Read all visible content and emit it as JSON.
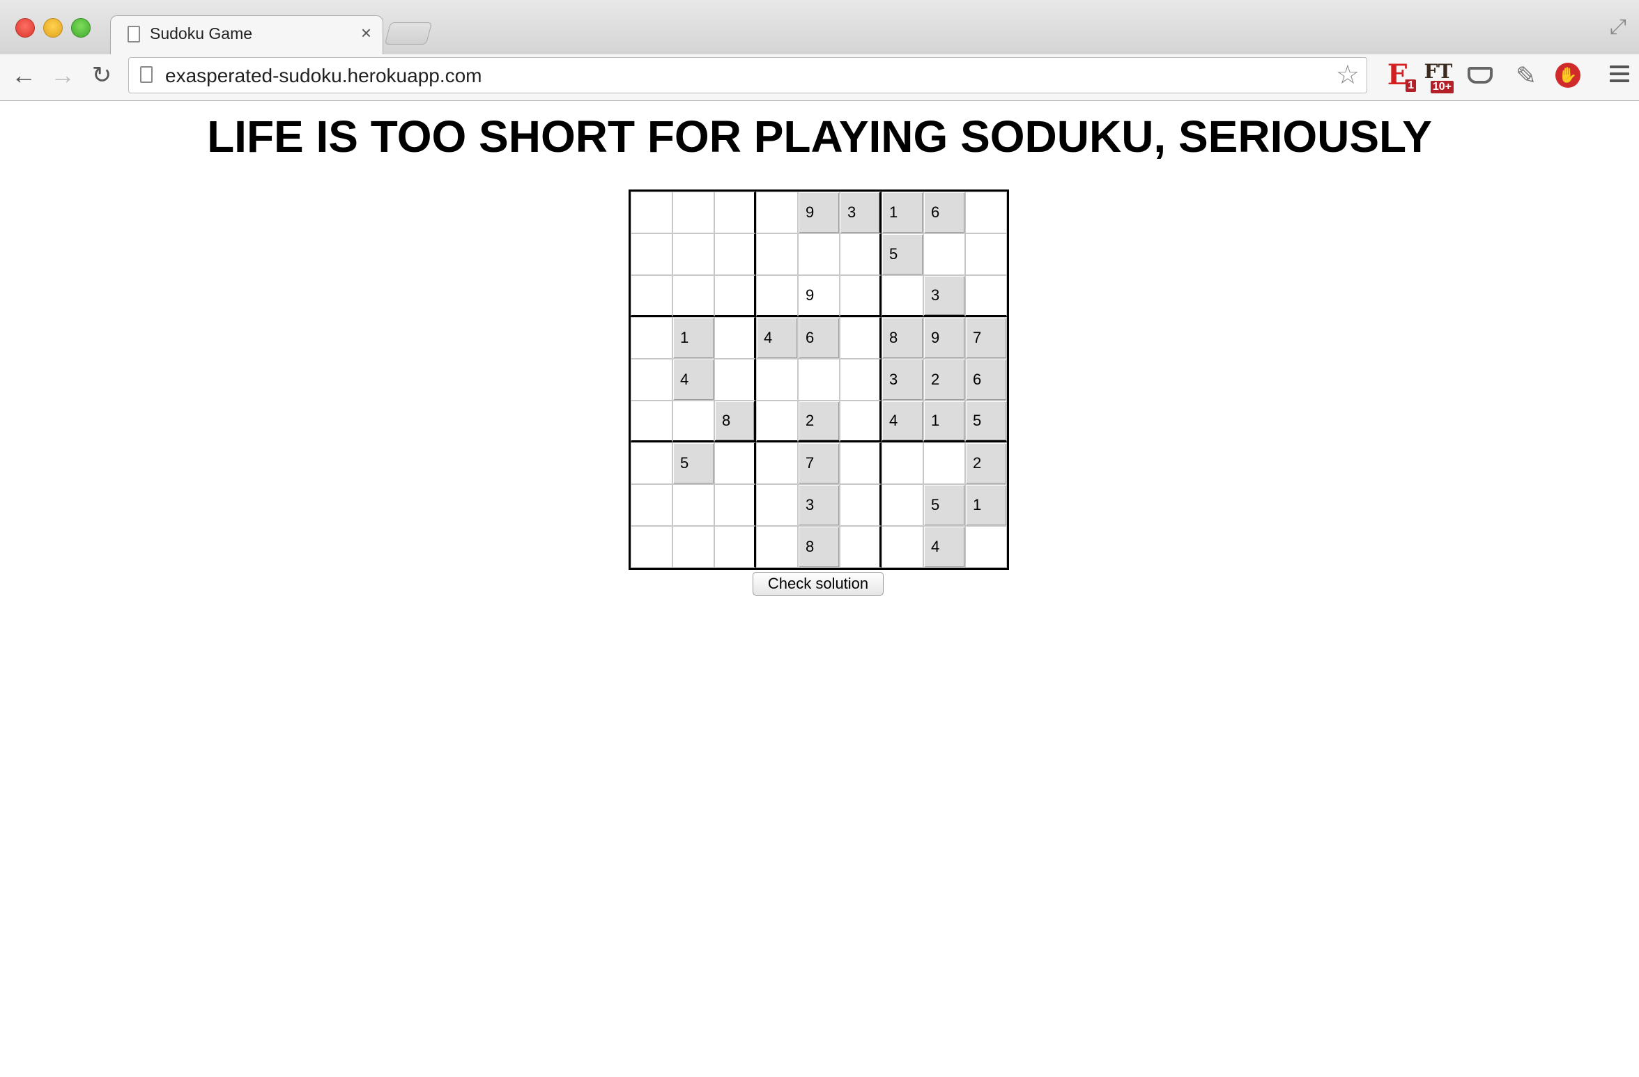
{
  "browser": {
    "tab_title": "Sudoku Game",
    "tab_close": "×",
    "url": "exasperated-sudoku.herokuapp.com",
    "nav": {
      "back": "←",
      "forward": "→",
      "reload": "↻",
      "star": "☆"
    },
    "extensions": {
      "e_label": "E",
      "e_badge": "1",
      "ft_label": "FT",
      "ft_badge": "10+",
      "dropper": "✎",
      "stop": "✋"
    },
    "fullscreen": "⤢"
  },
  "page": {
    "heading": "LIFE IS TOO SHORT FOR PLAYING SODUKU, SERIOUSLY",
    "check_button_label": "Check solution"
  },
  "board": {
    "values": [
      [
        "",
        "",
        "",
        "",
        "9",
        "3",
        "1",
        "6",
        ""
      ],
      [
        "",
        "",
        "",
        "",
        "",
        "",
        "5",
        "",
        ""
      ],
      [
        "",
        "",
        "",
        "",
        "9",
        "",
        "",
        "3",
        ""
      ],
      [
        "",
        "1",
        "",
        "4",
        "6",
        "",
        "8",
        "9",
        "7"
      ],
      [
        "",
        "4",
        "",
        "",
        "",
        "",
        "3",
        "2",
        "6"
      ],
      [
        "",
        "",
        "8",
        "",
        "2",
        "",
        "4",
        "1",
        "5"
      ],
      [
        "",
        "5",
        "",
        "",
        "7",
        "",
        "",
        "",
        "2"
      ],
      [
        "",
        "",
        "",
        "",
        "3",
        "",
        "",
        "5",
        "1"
      ],
      [
        "",
        "",
        "",
        "",
        "8",
        "",
        "",
        "4",
        ""
      ]
    ],
    "shaded": [
      [
        false,
        false,
        false,
        false,
        true,
        true,
        true,
        true,
        false
      ],
      [
        false,
        false,
        false,
        false,
        false,
        false,
        true,
        false,
        false
      ],
      [
        false,
        false,
        false,
        false,
        false,
        false,
        false,
        true,
        false
      ],
      [
        false,
        true,
        false,
        true,
        true,
        false,
        true,
        true,
        true
      ],
      [
        false,
        true,
        false,
        false,
        false,
        false,
        true,
        true,
        true
      ],
      [
        false,
        false,
        true,
        false,
        true,
        false,
        true,
        true,
        true
      ],
      [
        false,
        true,
        false,
        false,
        true,
        false,
        false,
        false,
        true
      ],
      [
        false,
        false,
        false,
        false,
        true,
        false,
        false,
        true,
        true
      ],
      [
        false,
        false,
        false,
        false,
        true,
        false,
        false,
        true,
        false
      ]
    ]
  }
}
